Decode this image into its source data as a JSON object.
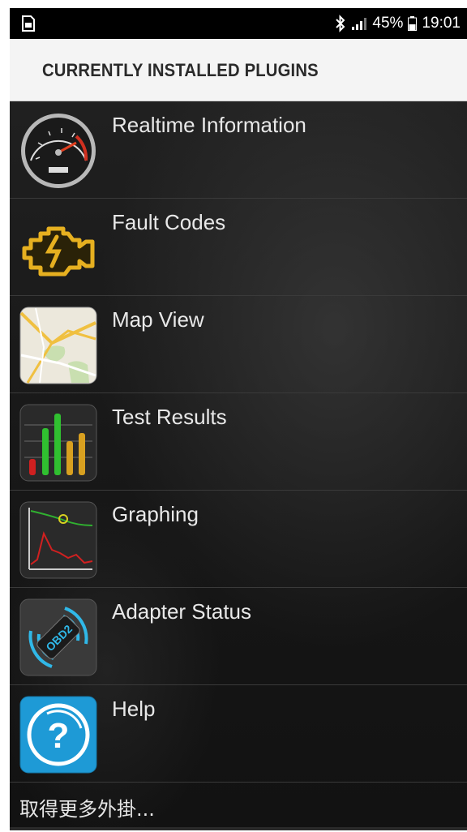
{
  "status_bar": {
    "notification_icon": "sim-card-icon",
    "bluetooth_icon": "bluetooth-icon",
    "signal_icon": "signal-icon",
    "battery": "45%",
    "battery_icon": "battery-icon",
    "time": "19:01"
  },
  "header": {
    "title": "CURRENTLY INSTALLED PLUGINS"
  },
  "plugins": [
    {
      "label": "Realtime Information",
      "icon": "speedometer-icon"
    },
    {
      "label": "Fault Codes",
      "icon": "check-engine-icon"
    },
    {
      "label": "Map View",
      "icon": "map-icon"
    },
    {
      "label": "Test Results",
      "icon": "bar-graph-icon"
    },
    {
      "label": "Graphing",
      "icon": "line-graph-icon"
    },
    {
      "label": "Adapter Status",
      "icon": "obd2-adapter-icon"
    },
    {
      "label": "Help",
      "icon": "help-icon"
    }
  ],
  "more_plugins": "取得更多外掛..."
}
